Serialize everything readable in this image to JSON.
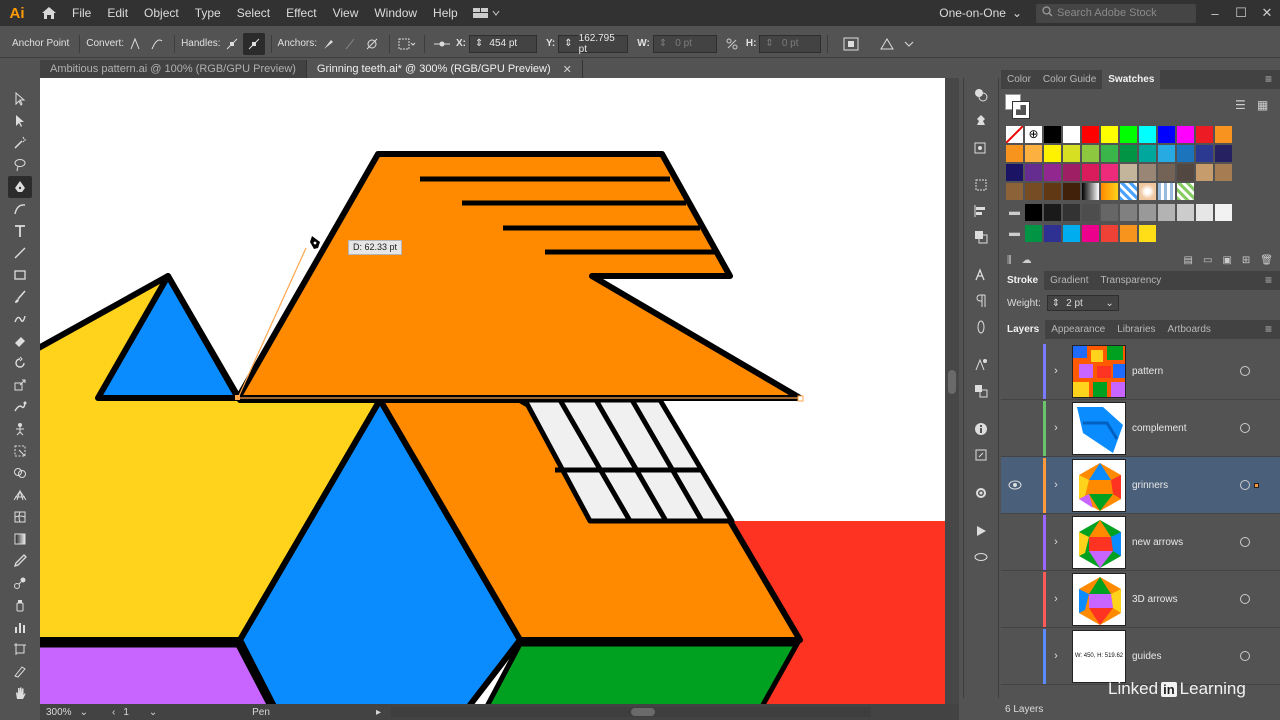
{
  "app": {
    "logo": "Ai"
  },
  "menu": [
    "File",
    "Edit",
    "Object",
    "Type",
    "Select",
    "Effect",
    "View",
    "Window",
    "Help"
  ],
  "workspace": "One-on-One",
  "search": {
    "placeholder": "Search Adobe Stock"
  },
  "control_bar": {
    "tool_label": "Anchor Point",
    "convert_label": "Convert:",
    "handles_label": "Handles:",
    "anchors_label": "Anchors:",
    "x_label": "X:",
    "x_value": "454 pt",
    "y_label": "Y:",
    "y_value": "162.795 pt",
    "w_label": "W:",
    "w_value": "0 pt",
    "h_label": "H:",
    "h_value": "0 pt"
  },
  "tabs": [
    {
      "label": "Ambitious pattern.ai @ 100% (RGB/GPU Preview)"
    },
    {
      "label": "Grinning teeth.ai* @ 300% (RGB/GPU Preview)"
    }
  ],
  "canvas": {
    "measure_tooltip": "D: 62.33 pt"
  },
  "status_bar": {
    "zoom": "300%",
    "artboard": "1",
    "tool": "Pen"
  },
  "panels": {
    "top_tabs": [
      "Color",
      "Color Guide",
      "Swatches"
    ],
    "stroke_tabs": [
      "Stroke",
      "Gradient",
      "Transparency"
    ],
    "stroke": {
      "weight_label": "Weight:",
      "weight_value": "2 pt"
    },
    "layers_tabs": [
      "Layers",
      "Appearance",
      "Libraries",
      "Artboards"
    ],
    "layers": [
      {
        "name": "pattern",
        "color": "#7a7aff"
      },
      {
        "name": "complement",
        "color": "#6ac26a"
      },
      {
        "name": "grinners",
        "color": "#ff9a3c"
      },
      {
        "name": "new arrows",
        "color": "#9b66ff"
      },
      {
        "name": "3D arrows",
        "color": "#ff5a5a"
      },
      {
        "name": "guides",
        "color": "#5a8cff"
      }
    ],
    "guides_thumb_text": "W: 450, H: 519.62",
    "layers_count": "6 Layers"
  },
  "swatches": {
    "row1": [
      "#000000",
      "#ffffff",
      "#ff0000",
      "#ffff00",
      "#00ff00",
      "#00ffff",
      "#0000ff",
      "#ff00ff",
      "#ed1c24",
      "#f7931e"
    ],
    "row2": [
      "#f7941d",
      "#fbb040",
      "#fff200",
      "#d7df23",
      "#8dc63f",
      "#39b54a",
      "#009444",
      "#00a79d",
      "#27aae1",
      "#1c75bc",
      "#2b3990",
      "#262262"
    ],
    "row3": [
      "#1b1464",
      "#662d91",
      "#92278f",
      "#9e1f63",
      "#da1c5c",
      "#ee2a7b",
      "#c2b59b",
      "#998675",
      "#736357",
      "#534741",
      "#c69c6d",
      "#a67c52"
    ],
    "row4": [
      "#8c6239",
      "#754c24",
      "#603813",
      "#42210b"
    ],
    "grays": [
      "#000000",
      "#1a1a1a",
      "#333333",
      "#4d4d4d",
      "#666666",
      "#808080",
      "#999999",
      "#b3b3b3",
      "#cccccc",
      "#e6e6e6",
      "#f2f2f2"
    ],
    "group2": [
      "#009444",
      "#2e3192",
      "#00aeef",
      "#ec008c",
      "#ef4136",
      "#f7941d",
      "#ffde17"
    ]
  },
  "icons": [
    "home-icon",
    "search-icon",
    "pen-icon",
    "eye-icon",
    "close-icon"
  ],
  "watermark": {
    "brand": "Linked",
    "in": "in",
    "suffix": "Learning"
  }
}
